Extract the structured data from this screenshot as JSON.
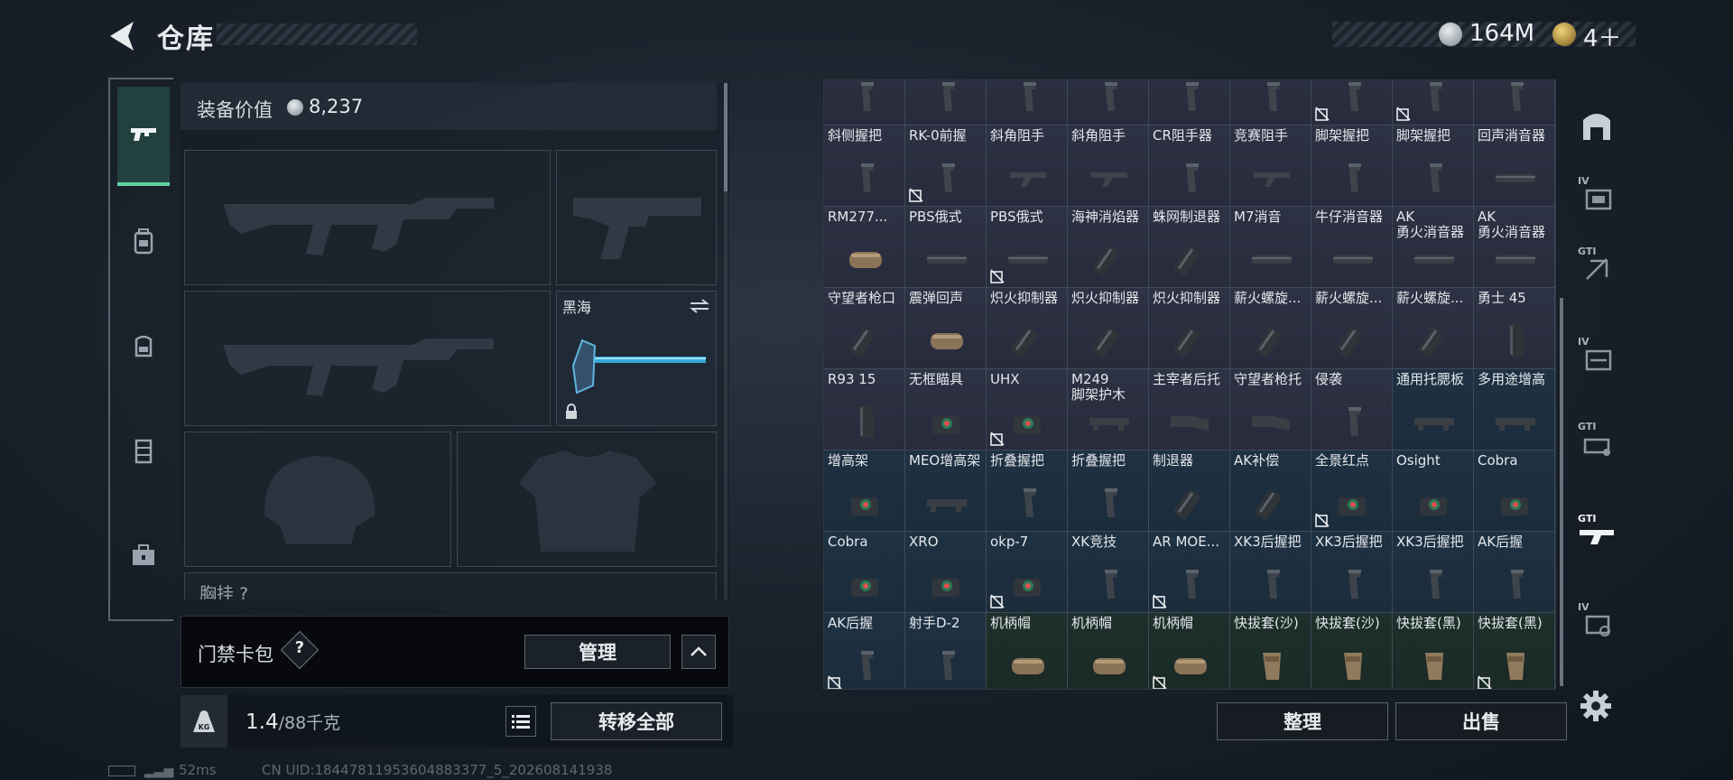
{
  "header": {
    "title": "仓库",
    "currency": [
      {
        "icon": "silver-coin-icon",
        "value": "164M"
      },
      {
        "icon": "gold-coin-icon",
        "value": "4＋"
      }
    ]
  },
  "left_tabs": [
    "gun-icon",
    "backpack-icon",
    "rig-icon",
    "case-icon",
    "toolbox-icon"
  ],
  "equipment": {
    "value_label": "装备价值",
    "value": "8,237",
    "melee_name": "黑海",
    "chest_label": "胸挂 ?"
  },
  "keycard": {
    "label": "门禁卡包",
    "help": "?",
    "manage_label": "管理"
  },
  "weight": {
    "current": "1.4",
    "capacity": "/88千克",
    "transfer_label": "转移全部"
  },
  "status": {
    "ping": "52ms",
    "uid": "CN UID:18447811953604883377_5_202608141938"
  },
  "inventory": {
    "rows": [
      [
        {
          "name": "",
          "bg": "purple",
          "icon": "grip"
        },
        {
          "name": "",
          "bg": "purple",
          "icon": "grip"
        },
        {
          "name": "",
          "bg": "purple",
          "icon": "grip"
        },
        {
          "name": "",
          "bg": "purple",
          "icon": "grip"
        },
        {
          "name": "",
          "bg": "purple",
          "icon": "grip"
        },
        {
          "name": "",
          "bg": "purple",
          "icon": "grip"
        },
        {
          "name": "",
          "bg": "purple",
          "icon": "grip",
          "flag": true
        },
        {
          "name": "",
          "bg": "purple",
          "icon": "grip",
          "flag": true
        },
        {
          "name": "",
          "bg": "purple",
          "icon": "grip"
        }
      ],
      [
        {
          "name": "斜侧握把",
          "bg": "purple",
          "icon": "grip"
        },
        {
          "name": "RK-0前握",
          "bg": "purple",
          "icon": "grip",
          "flag": true
        },
        {
          "name": "斜角阻手",
          "bg": "purple",
          "icon": "handstop"
        },
        {
          "name": "斜角阻手",
          "bg": "purple",
          "icon": "handstop"
        },
        {
          "name": "CR阻手器",
          "bg": "purple",
          "icon": "grip"
        },
        {
          "name": "竞赛阻手",
          "bg": "purple",
          "icon": "handstop"
        },
        {
          "name": "脚架握把",
          "bg": "purple",
          "icon": "grip"
        },
        {
          "name": "脚架握把",
          "bg": "purple",
          "icon": "grip"
        },
        {
          "name": "回声消音器",
          "bg": "purple",
          "icon": "suppressor"
        }
      ],
      [
        {
          "name": "RM277...",
          "bg": "purple",
          "icon": "can"
        },
        {
          "name": "PBS俄式",
          "bg": "purple",
          "icon": "suppressor"
        },
        {
          "name": "PBS俄式",
          "bg": "purple",
          "icon": "suppressor",
          "flag": true
        },
        {
          "name": "海神消焰器",
          "bg": "purple",
          "icon": "flash"
        },
        {
          "name": "蛛网制退器",
          "bg": "purple",
          "icon": "flash"
        },
        {
          "name": "M7消音",
          "bg": "purple",
          "icon": "suppressor"
        },
        {
          "name": "牛仔消音器",
          "bg": "purple",
          "icon": "suppressor"
        },
        {
          "name": "AK\n勇火消音器",
          "bg": "purple",
          "icon": "suppressor"
        },
        {
          "name": "AK\n勇火消音器",
          "bg": "purple",
          "icon": "suppressor"
        }
      ],
      [
        {
          "name": "守望者枪口",
          "bg": "purple",
          "icon": "flash"
        },
        {
          "name": "震弹回声",
          "bg": "purple",
          "icon": "can"
        },
        {
          "name": "炽火抑制器",
          "bg": "purple",
          "icon": "flash"
        },
        {
          "name": "炽火抑制器",
          "bg": "purple",
          "icon": "flash"
        },
        {
          "name": "炽火抑制器",
          "bg": "purple",
          "icon": "flash"
        },
        {
          "name": "薪火螺旋...",
          "bg": "purple",
          "icon": "flash"
        },
        {
          "name": "薪火螺旋...",
          "bg": "purple",
          "icon": "flash"
        },
        {
          "name": "薪火螺旋...",
          "bg": "purple",
          "icon": "flash"
        },
        {
          "name": "勇士 45",
          "bg": "purple",
          "icon": "mag"
        }
      ],
      [
        {
          "name": "R93 15",
          "bg": "purple",
          "icon": "mag"
        },
        {
          "name": "无框瞄具",
          "bg": "purple",
          "icon": "sight"
        },
        {
          "name": "UHX",
          "bg": "purple",
          "icon": "sight",
          "flag": true
        },
        {
          "name": "M249\n脚架护木",
          "bg": "purple",
          "icon": "rail"
        },
        {
          "name": "主宰者后托",
          "bg": "purple",
          "icon": "stock"
        },
        {
          "name": "守望者枪托",
          "bg": "purple",
          "icon": "stock"
        },
        {
          "name": "侵袭",
          "bg": "purple",
          "icon": "grip"
        },
        {
          "name": "通用托腮板",
          "bg": "blue",
          "icon": "rail"
        },
        {
          "name": "多用途增高",
          "bg": "blue",
          "icon": "rail"
        }
      ],
      [
        {
          "name": "增高架",
          "bg": "blue",
          "icon": "sight"
        },
        {
          "name": "MEO增高架",
          "bg": "blue",
          "icon": "rail"
        },
        {
          "name": "折叠握把",
          "bg": "blue",
          "icon": "grip"
        },
        {
          "name": "折叠握把",
          "bg": "blue",
          "icon": "grip"
        },
        {
          "name": "制退器",
          "bg": "blue",
          "icon": "flash"
        },
        {
          "name": "AK补偿",
          "bg": "blue",
          "icon": "flash"
        },
        {
          "name": "全景红点",
          "bg": "blue",
          "icon": "sight",
          "flag": true
        },
        {
          "name": "Osight",
          "bg": "blue",
          "icon": "sight"
        },
        {
          "name": "Cobra",
          "bg": "blue",
          "icon": "sight"
        }
      ],
      [
        {
          "name": "Cobra",
          "bg": "blue",
          "icon": "sight"
        },
        {
          "name": "XRO",
          "bg": "blue",
          "icon": "sight"
        },
        {
          "name": "okp-7",
          "bg": "blue",
          "icon": "sight",
          "flag": true
        },
        {
          "name": "XK竞技",
          "bg": "blue",
          "icon": "grip"
        },
        {
          "name": "AR MOE...",
          "bg": "blue",
          "icon": "grip",
          "flag": true
        },
        {
          "name": "XK3后握把",
          "bg": "blue",
          "icon": "grip"
        },
        {
          "name": "XK3后握把",
          "bg": "blue",
          "icon": "grip"
        },
        {
          "name": "XK3后握把",
          "bg": "blue",
          "icon": "grip"
        },
        {
          "name": "AK后握",
          "bg": "blue",
          "icon": "grip"
        }
      ],
      [
        {
          "name": "AK后握",
          "bg": "blue",
          "icon": "grip",
          "flag": true
        },
        {
          "name": "射手D-2",
          "bg": "blue",
          "icon": "grip"
        },
        {
          "name": "机柄帽",
          "bg": "green",
          "icon": "can"
        },
        {
          "name": "机柄帽",
          "bg": "green",
          "icon": "can"
        },
        {
          "name": "机柄帽",
          "bg": "green",
          "icon": "can",
          "flag": true
        },
        {
          "name": "快拔套(沙)",
          "bg": "green",
          "icon": "holster"
        },
        {
          "name": "快拔套(沙)",
          "bg": "green",
          "icon": "holster"
        },
        {
          "name": "快拔套(黑)",
          "bg": "green",
          "icon": "holster"
        },
        {
          "name": "快拔套(黑)",
          "bg": "green",
          "icon": "holster",
          "flag": true
        }
      ]
    ],
    "organize_label": "整理",
    "sell_label": "出售"
  },
  "right_tabs": [
    {
      "icon": "all-category-icon",
      "text": ""
    },
    {
      "icon": "tier4-mod-icon",
      "text": "IV"
    },
    {
      "icon": "gti-mod-icon",
      "text": "GTI"
    },
    {
      "icon": "tier4-mod-icon-2",
      "text": "IV"
    },
    {
      "icon": "gti-mod-icon-2",
      "text": "GTI"
    },
    {
      "icon": "gti-rifle-icon",
      "text": "GTI"
    },
    {
      "icon": "tier4-mod-icon-3",
      "text": "IV"
    }
  ],
  "colors": {
    "accent": "#5fd3a3",
    "rarity_purple": "#2d3244",
    "rarity_blue": "#1f3243",
    "rarity_green": "#1e302b"
  }
}
